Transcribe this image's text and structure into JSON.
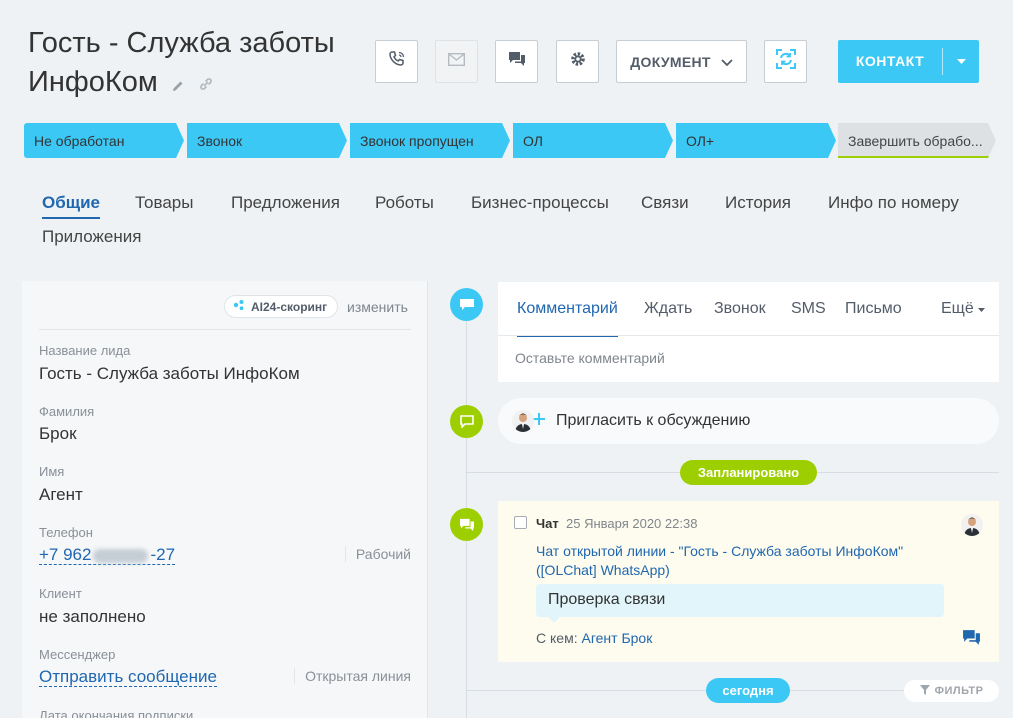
{
  "header": {
    "title": "Гость - Служба заботы ИнфоКом"
  },
  "toolbar": {
    "document_label": "ДОКУМЕНТ",
    "contact_label": "КОНТАКТ"
  },
  "stages": [
    "Не обработан",
    "Звонок",
    "Звонок пропущен",
    "ОЛ",
    "ОЛ+",
    "Завершить обрабо..."
  ],
  "colors": {
    "accent": "#3bc8f5",
    "green": "#9dcf00",
    "link": "#2067b0"
  },
  "tabs": [
    "Общие",
    "Товары",
    "Предложения",
    "Роботы",
    "Бизнес-процессы",
    "Связи",
    "История",
    "Инфо по номеру",
    "Приложения"
  ],
  "left": {
    "scoring_label": "AI24-скоринг",
    "change_label": "изменить",
    "fields": [
      {
        "label": "Название лида",
        "value": "Гость - Служба заботы ИнфоКом"
      },
      {
        "label": "Фамилия",
        "value": "Брок"
      },
      {
        "label": "Имя",
        "value": "Агент"
      },
      {
        "label": "Телефон",
        "value_prefix": "+7 962",
        "value_suffix": "-27",
        "extra": "Рабочий"
      },
      {
        "label": "Клиент",
        "value": "не заполнено"
      },
      {
        "label": "Мессенджер",
        "value": "Отправить сообщение",
        "extra": "Открытая линия"
      },
      {
        "label": "Дата окончания подписки"
      }
    ]
  },
  "editor": {
    "tabs": [
      "Комментарий",
      "Ждать",
      "Звонок",
      "SMS",
      "Письмо"
    ],
    "more_label": "Ещё",
    "placeholder": "Оставьте комментарий"
  },
  "invite_label": "Пригласить к обсуждению",
  "planned_badge": "Запланировано",
  "today_badge": "сегодня",
  "filter_label": "ФИЛЬТР",
  "chat": {
    "title": "Чат",
    "date": "25 Января 2020 22:38",
    "link_text": "Чат открытой линии - \"Гость - Служба заботы ИнфоКом\" ([OLChat] WhatsApp)",
    "message": "Проверка связи",
    "with_label": "С кем:",
    "with_name": "Агент Брок"
  }
}
